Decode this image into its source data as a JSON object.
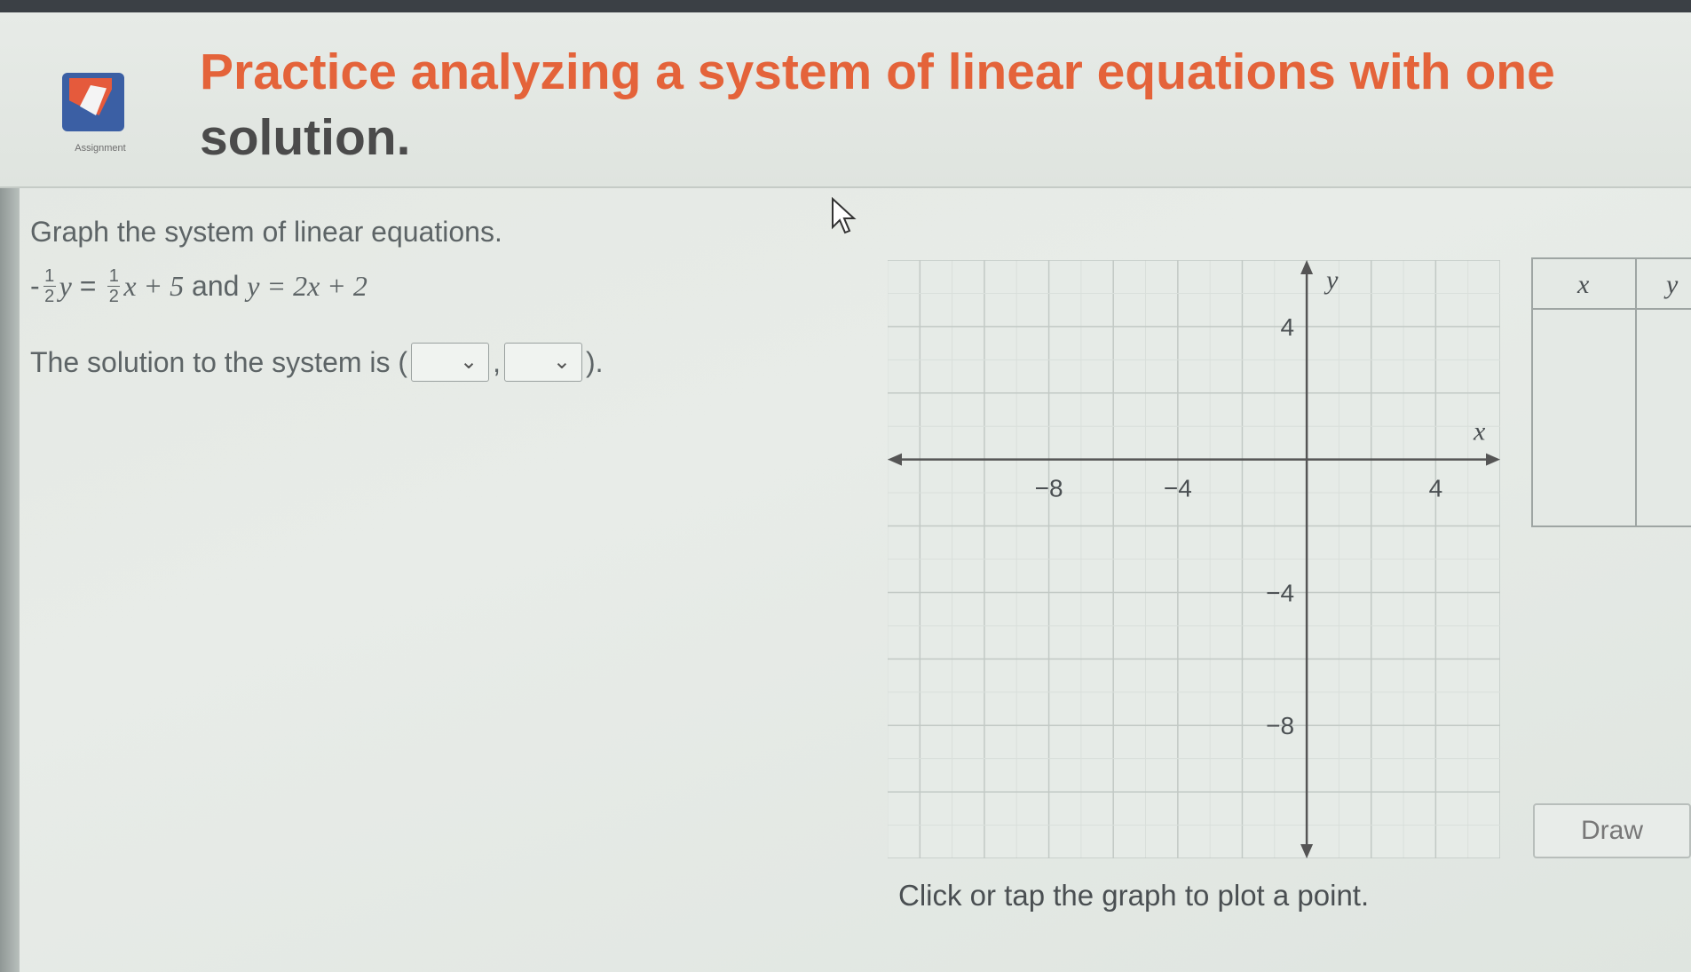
{
  "header": {
    "logo_text": "Assignment",
    "title_line1": "Practice analyzing a system of linear equations with one",
    "title_line2": "solution."
  },
  "question": {
    "instruction": "Graph the system of linear equations.",
    "eq1_neg": "-",
    "frac_num": "1",
    "frac_den": "2",
    "eq1_y": "y",
    "eq1_eq": " = ",
    "eq1_rest": "x + 5",
    "connector": " and ",
    "eq2": "y = 2x + 2",
    "solution_prefix": "The solution to the system is (",
    "solution_comma": ",",
    "solution_suffix": ")."
  },
  "graph": {
    "x_axis_label": "x",
    "y_axis_label": "y",
    "x_ticks": [
      "−8",
      "−4",
      "4"
    ],
    "y_ticks": [
      "4",
      "−4",
      "−8"
    ],
    "x_range": [
      -13,
      6
    ],
    "y_range": [
      -12,
      6
    ]
  },
  "table": {
    "col_x": "x",
    "col_y": "y"
  },
  "draw_button": "Draw",
  "hint": "Click or tap the graph to plot a point."
}
